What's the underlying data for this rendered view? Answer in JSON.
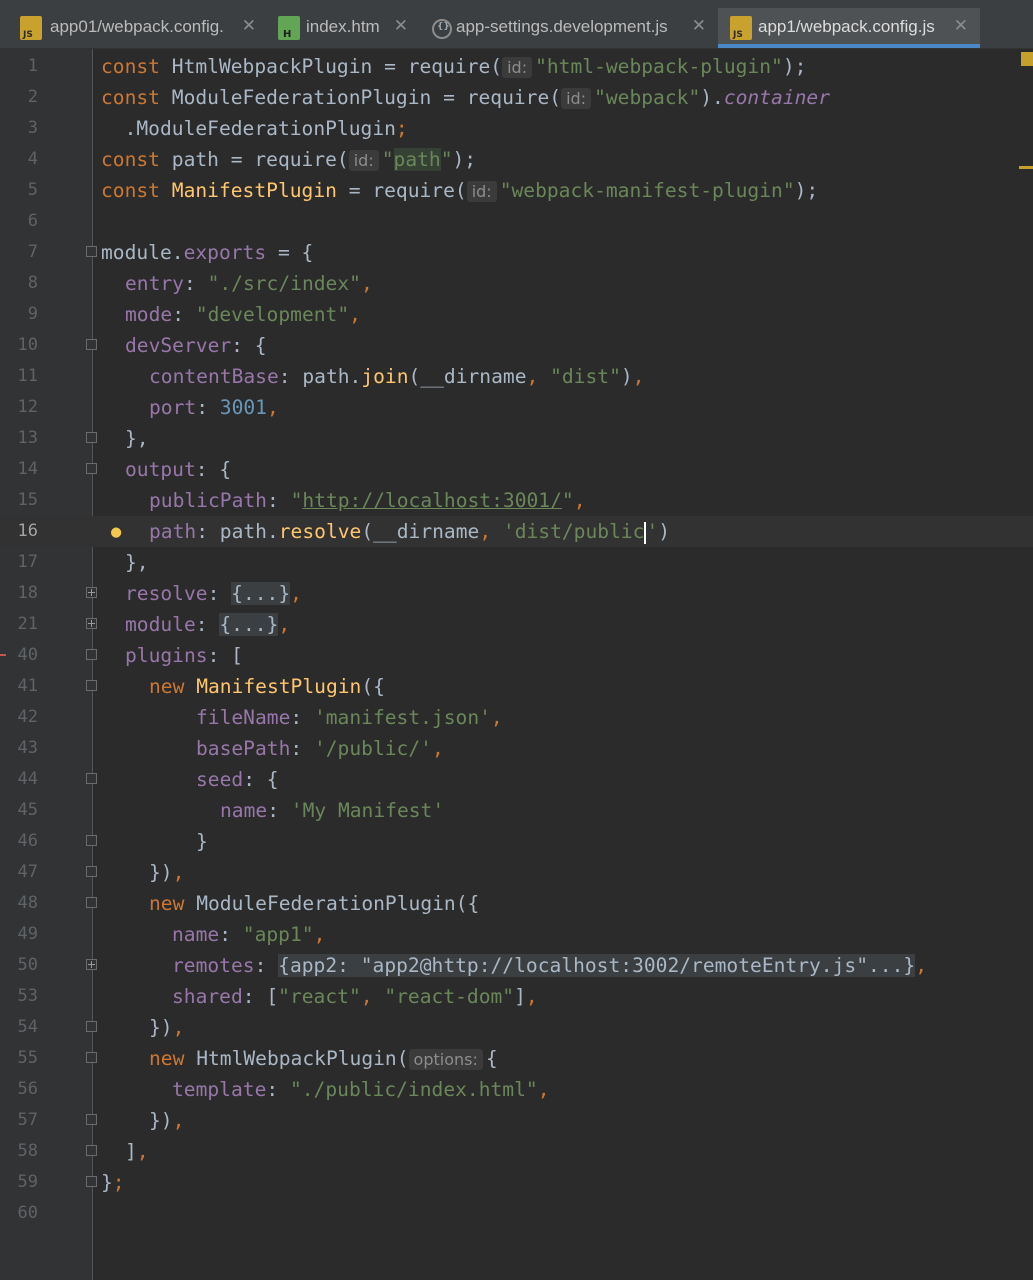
{
  "tabs": [
    {
      "label": "app01/webpack.config.",
      "icon": "js-file-icon",
      "icon_text": "JS",
      "active": false
    },
    {
      "label": "index.htm",
      "icon": "html-file-icon",
      "icon_text": "H",
      "active": false
    },
    {
      "label": "app-settings.development.js",
      "icon": "settings-json-file-icon",
      "icon_text": "{}",
      "active": false
    },
    {
      "label": "app1/webpack.config.js",
      "icon": "js-file-icon",
      "icon_text": "JS",
      "active": true
    }
  ],
  "close_glyph": "✕",
  "hints": {
    "id": "id:",
    "options": "options:"
  },
  "line_numbers": [
    "1",
    "2",
    "3",
    "4",
    "5",
    "6",
    "7",
    "8",
    "9",
    "10",
    "11",
    "12",
    "13",
    "14",
    "15",
    "16",
    "17",
    "18",
    "21",
    "40",
    "41",
    "42",
    "43",
    "44",
    "45",
    "46",
    "47",
    "48",
    "49",
    "50",
    "53",
    "54",
    "55",
    "56",
    "57",
    "58",
    "59",
    "60"
  ],
  "code": {
    "l1": {
      "kw": "const",
      "name": "HtmlWebpackPlugin",
      "eq": " = require(",
      "str": "\"html-webpack-plugin\"",
      "end": ");"
    },
    "l2": {
      "kw": "const",
      "name": "ModuleFederationPlugin",
      "eq": " = require(",
      "str": "\"webpack\"",
      "mid": ").",
      "container": "container"
    },
    "l3": {
      "text": "  .ModuleFederationPlugin",
      "semi": ";"
    },
    "l4": {
      "kw": "const",
      "name": "path",
      "eq": " = require(",
      "q1": "\"",
      "hl": "path",
      "q2": "\"",
      "end": ");"
    },
    "l5": {
      "kw": "const",
      "name": "ManifestPlugin",
      "eq": " = require(",
      "str": "\"webpack-manifest-plugin\"",
      "end": ");"
    },
    "l7": {
      "mod": "module",
      "dot": ".",
      "exports": "exports",
      "rest": " = {"
    },
    "l8": {
      "prop": "entry",
      "colon": ": ",
      "str": "\"./src/index\"",
      "comma": ","
    },
    "l9": {
      "prop": "mode",
      "colon": ": ",
      "str": "\"development\"",
      "comma": ","
    },
    "l10": {
      "prop": "devServer",
      "rest": ": {"
    },
    "l11": {
      "prop": "contentBase",
      "colon": ": path.",
      "fn": "join",
      "open": "(__dirname",
      "comma1": ", ",
      "str": "\"dist\"",
      "close": ")",
      "comma": ","
    },
    "l12": {
      "prop": "port",
      "colon": ": ",
      "num": "3001",
      "comma": ","
    },
    "l13": {
      "text": "},"
    },
    "l14": {
      "prop": "output",
      "rest": ": {"
    },
    "l15": {
      "prop": "publicPath",
      "colon": ": ",
      "q1": "\"",
      "url": "http://localhost:3001/",
      "q2": "\"",
      "comma": ","
    },
    "l16": {
      "prop": "path",
      "colon": ": path.",
      "fn": "resolve",
      "open": "(__dirname",
      "comma1": ", ",
      "str": "'dist/public",
      "str2": "'",
      "close": ")"
    },
    "l17": {
      "text": "},"
    },
    "l18": {
      "prop": "resolve",
      "colon": ": ",
      "fold": "{...}",
      "comma": ","
    },
    "l21": {
      "prop": "module",
      "colon": ": ",
      "fold": "{...}",
      "comma": ","
    },
    "l40": {
      "prop": "plugins",
      "rest": ": ["
    },
    "l41": {
      "kw": "new",
      "fn": "ManifestPlugin",
      "rest": "({"
    },
    "l42": {
      "prop": "fileName",
      "colon": ": ",
      "str": "'manifest.json'",
      "comma": ","
    },
    "l43": {
      "prop": "basePath",
      "colon": ": ",
      "str": "'/public/'",
      "comma": ","
    },
    "l44": {
      "prop": "seed",
      "rest": ": {"
    },
    "l45": {
      "prop": "name",
      "colon": ": ",
      "str": "'My Manifest'"
    },
    "l46": {
      "text": "}"
    },
    "l47": {
      "text": "})",
      "comma": ","
    },
    "l48": {
      "kw": "new",
      "fn": "ModuleFederationPlugin",
      "rest": "({"
    },
    "l49": {
      "prop": "name",
      "colon": ": ",
      "str": "\"app1\"",
      "comma": ","
    },
    "l50": {
      "prop": "remotes",
      "colon": ": ",
      "fold": "{app2: \"app2@http://localhost:3002/remoteEntry.js\"...}",
      "comma": ","
    },
    "l53": {
      "prop": "shared",
      "colon": ": [",
      "str1": "\"react\"",
      "comma1": ", ",
      "str2": "\"react-dom\"",
      "close": "]",
      "comma": ","
    },
    "l54": {
      "text": "})",
      "comma": ","
    },
    "l55": {
      "kw": "new",
      "fn": "HtmlWebpackPlugin",
      "open": "(",
      "rest": "{"
    },
    "l56": {
      "prop": "template",
      "colon": ": ",
      "str": "\"./public/index.html\"",
      "comma": ","
    },
    "l57": {
      "text": "})",
      "comma": ","
    },
    "l58": {
      "text": "]",
      "comma": ","
    },
    "l59": {
      "text": "}",
      "semi": ";"
    }
  }
}
